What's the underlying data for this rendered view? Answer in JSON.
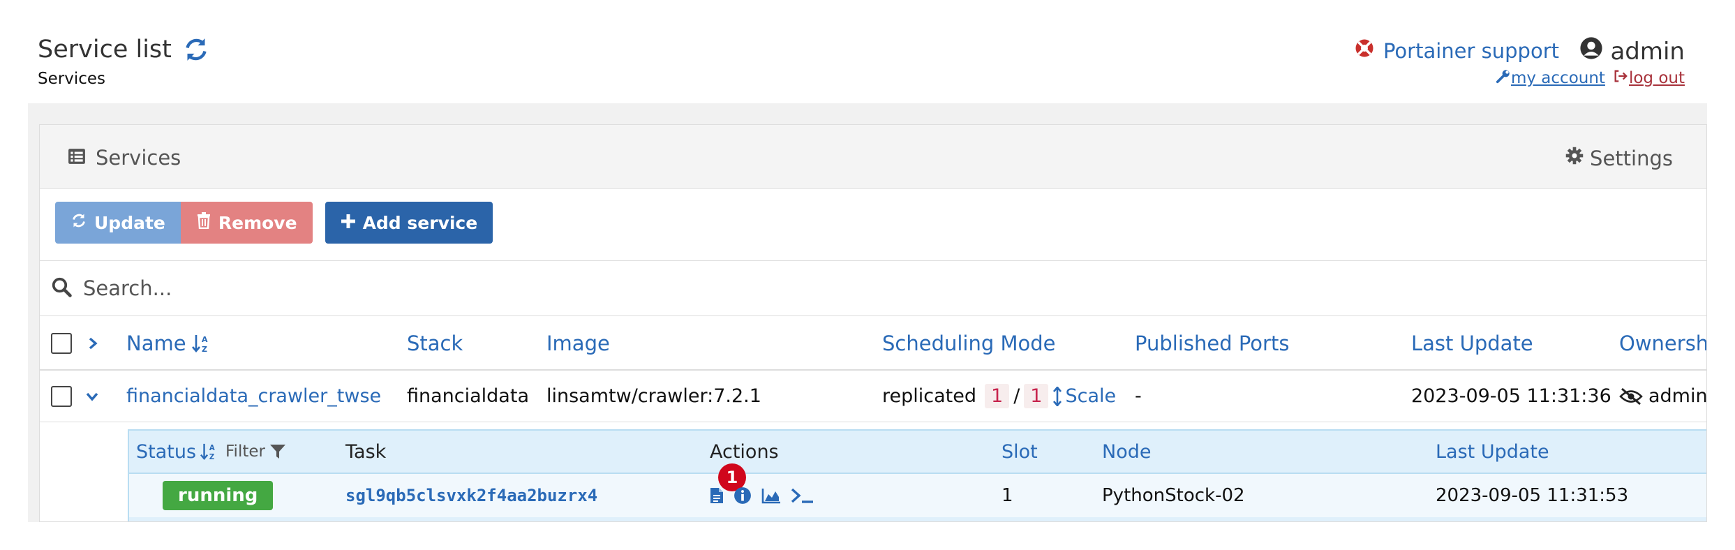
{
  "header": {
    "title": "Service list",
    "subtitle": "Services",
    "support_label": "Portainer support",
    "user_label": "admin",
    "my_account_label": "my account",
    "logout_label": "log out"
  },
  "widget": {
    "title": "Services",
    "settings_label": "Settings",
    "buttons": {
      "update": "Update",
      "remove": "Remove",
      "add": "Add service"
    },
    "search_placeholder": "Search..."
  },
  "table": {
    "columns": {
      "name": "Name",
      "stack": "Stack",
      "image": "Image",
      "scheduling": "Scheduling Mode",
      "ports": "Published Ports",
      "last_update": "Last Update",
      "ownership": "Ownership"
    },
    "rows": [
      {
        "name": "financialdata_crawler_twse",
        "stack": "financialdata",
        "image": "linsamtw/crawler:7.2.1",
        "mode": "replicated",
        "running": "1",
        "separator": "/",
        "desired": "1",
        "scale_label": "Scale",
        "ports": "-",
        "last_update": "2023-09-05 11:31:36",
        "ownership": "administrators"
      }
    ]
  },
  "tasks": {
    "columns": {
      "status": "Status",
      "filter": "Filter",
      "task": "Task",
      "actions": "Actions",
      "slot": "Slot",
      "node": "Node",
      "last_update": "Last Update"
    },
    "rows": [
      {
        "status": "running",
        "task": "sgl9qb5clsvxk2f4aa2buzrx4",
        "badge_count": "1",
        "slot": "1",
        "node": "PythonStock-02",
        "last_update": "2023-09-05 11:31:53"
      }
    ]
  },
  "colors": {
    "link": "#2a6ab7",
    "running": "#44a842",
    "update_button": "#7aa5d8",
    "remove_button": "#e38282",
    "add_button": "#2b64a9",
    "notification": "#d0071c"
  }
}
